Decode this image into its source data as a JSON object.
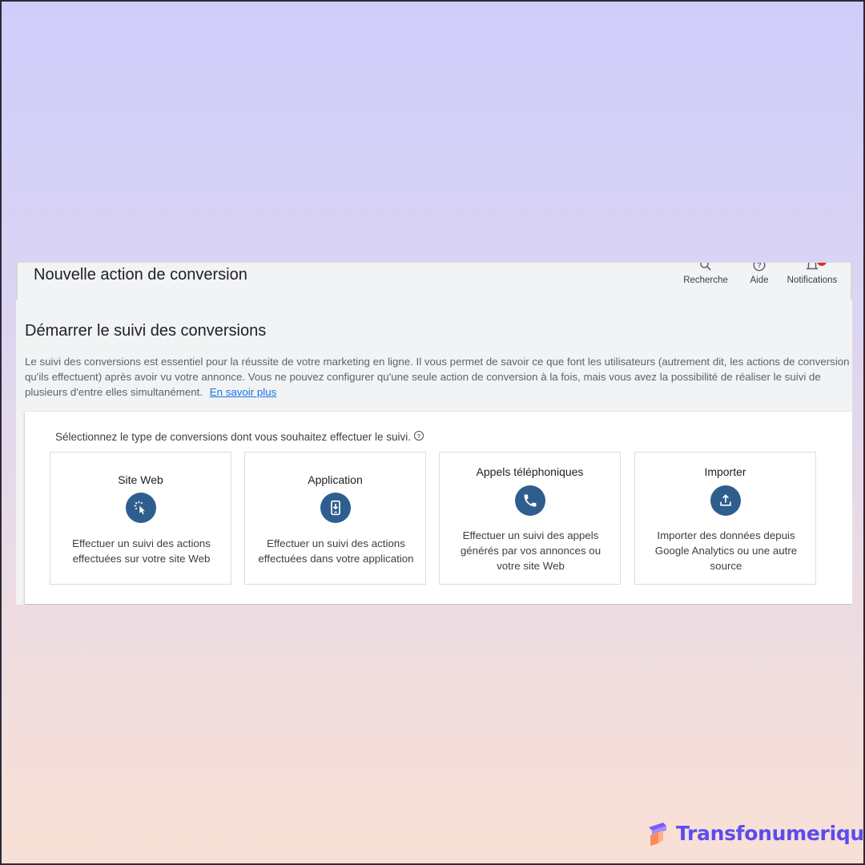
{
  "header": {
    "title": "Nouvelle action de conversion",
    "tools": {
      "search_label": "Recherche",
      "help_label": "Aide",
      "notifications_label": "Notifications"
    }
  },
  "main": {
    "section_title": "Démarrer le suivi des conversions",
    "description": "Le suivi des conversions est essentiel pour la réussite de votre marketing en ligne. Il vous permet de savoir ce que font les utilisateurs (autrement dit, les actions de conversion qu'ils effectuent) après avoir vu votre annonce. Vous ne pouvez configurer qu'une seule action de conversion à la fois, mais vous avez la possibilité de réaliser le suivi de plusieurs d'entre elles simultanément.",
    "learn_more_link": "En savoir plus",
    "prompt": "Sélectionnez le type de conversions dont vous souhaitez effectuer le suivi.",
    "options": [
      {
        "title": "Site Web",
        "icon": "cursor-click-icon",
        "description": "Effectuer un suivi des actions effectuées sur votre site Web"
      },
      {
        "title": "Application",
        "icon": "phone-download-icon",
        "description": "Effectuer un suivi des actions effectuées dans votre application"
      },
      {
        "title": "Appels téléphoniques",
        "icon": "phone-call-icon",
        "description": "Effectuer un suivi des appels générés par vos annonces ou votre site Web"
      },
      {
        "title": "Importer",
        "icon": "upload-icon",
        "description": "Importer des données depuis Google Analytics ou une autre source"
      }
    ]
  },
  "brand": {
    "name": "Transfonumerique"
  },
  "colors": {
    "accent_icon_bg": "#2e5e8e",
    "link": "#1a73e8",
    "badge": "#d93025",
    "brand": "#5b4cf0"
  }
}
